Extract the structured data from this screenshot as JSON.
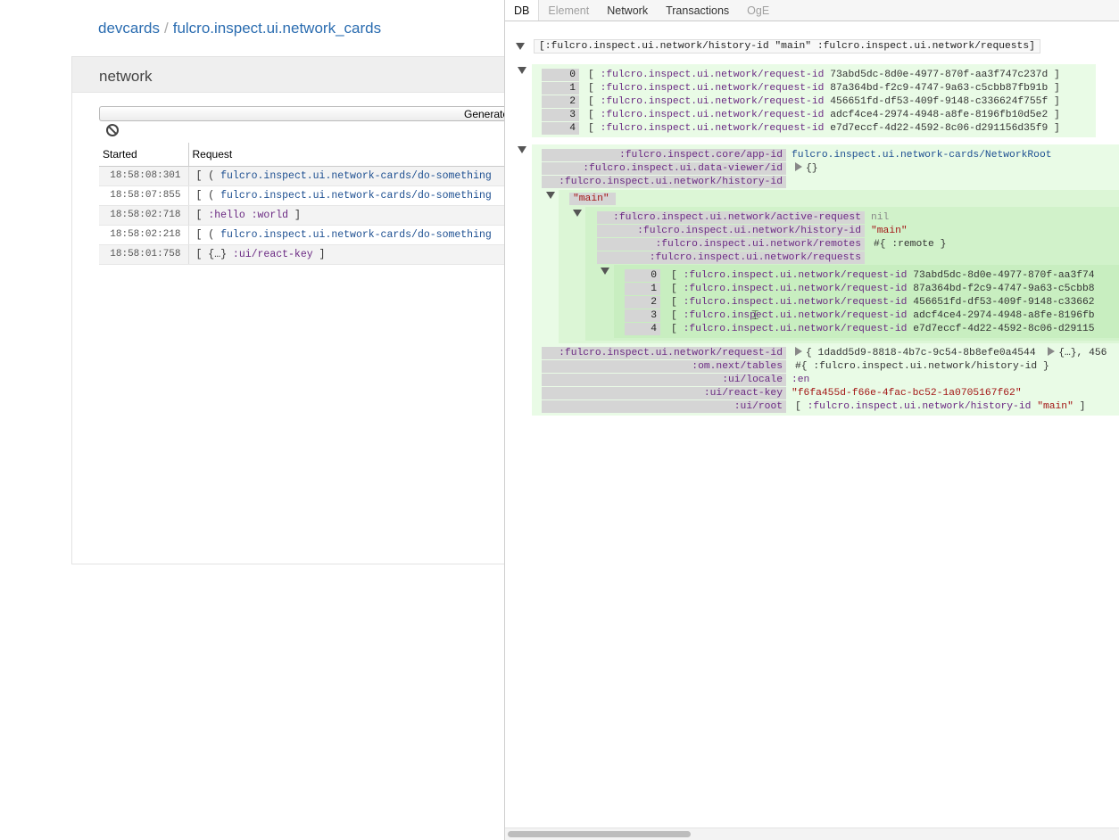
{
  "breadcrumb": {
    "root": "devcards",
    "separator": "/",
    "ns": "fulcro.inspect.ui.network_cards"
  },
  "card": {
    "title": "network",
    "generate_label": "Generate",
    "columns": [
      "Started",
      "Request"
    ],
    "rows": [
      {
        "started": "18:58:08:301",
        "prefix": "[ (",
        "sym": "fulcro.inspect.ui.network-cards/do-something"
      },
      {
        "started": "18:58:07:855",
        "prefix": "[ (",
        "sym": "fulcro.inspect.ui.network-cards/do-something"
      },
      {
        "started": "18:58:02:718",
        "prefix": "[",
        "kw": ":hello :world",
        "suffix": "]"
      },
      {
        "started": "18:58:02:218",
        "prefix": "[ (",
        "sym": "fulcro.inspect.ui.network-cards/do-something"
      },
      {
        "started": "18:58:01:758",
        "prefix": "[ {…}",
        "kw": ":ui/react-key",
        "suffix": "]"
      }
    ]
  },
  "inspector": {
    "tabs": [
      {
        "label": "DB",
        "state": "active"
      },
      {
        "label": "Element",
        "state": "disabled"
      },
      {
        "label": "Network",
        "state": "normal"
      },
      {
        "label": "Transactions",
        "state": "normal"
      },
      {
        "label": "OgE",
        "state": "disabled"
      }
    ],
    "path": "[:fulcro.inspect.ui.network/history-id \"main\" :fulcro.inspect.ui.network/requests]",
    "request_key": ":fulcro.inspect.ui.network/request-id",
    "requests_top": [
      {
        "idx": "0",
        "id": "73abd5dc-8d0e-4977-870f-aa3f747c237d"
      },
      {
        "idx": "1",
        "id": "87a364bd-f2c9-4747-9a63-c5cbb87fb91b"
      },
      {
        "idx": "2",
        "id": "456651fd-df53-409f-9148-c336624f755f"
      },
      {
        "idx": "3",
        "id": "adcf4ce4-2974-4948-a8fe-8196fb10d5e2"
      },
      {
        "idx": "4",
        "id": "e7d7eccf-4d22-4592-8c06-d291156d35f9"
      }
    ],
    "db": {
      "app_id_key": ":fulcro.inspect.core/app-id",
      "app_id_val": "fulcro.inspect.ui.network-cards/NetworkRoot",
      "data_viewer_key": ":fulcro.inspect.ui.data-viewer/id",
      "data_viewer_val": "{}",
      "history_key": ":fulcro.inspect.ui.network/history-id",
      "main_label": "\"main\"",
      "active_request_key": ":fulcro.inspect.ui.network/active-request",
      "active_request_val": "nil",
      "inner_history_key": ":fulcro.inspect.ui.network/history-id",
      "inner_history_val": "\"main\"",
      "remotes_key": ":fulcro.inspect.ui.network/remotes",
      "remotes_val": "#{ :remote }",
      "requests_key": ":fulcro.inspect.ui.network/requests",
      "requests_inner": [
        {
          "idx": "0",
          "id": "73abd5dc-8d0e-4977-870f-aa3f74"
        },
        {
          "idx": "1",
          "id": "87a364bd-f2c9-4747-9a63-c5cbb8"
        },
        {
          "idx": "2",
          "id": "456651fd-df53-409f-9148-c33662"
        },
        {
          "idx": "3",
          "id": "adcf4ce4-2974-4948-a8fe-8196fb"
        },
        {
          "idx": "4",
          "id": "e7d7eccf-4d22-4592-8c06-d29115"
        }
      ],
      "request_id_key": ":fulcro.inspect.ui.network/request-id",
      "request_id_val_a": "{ 1dadd5d9-8818-4b7c-9c54-8b8efe0a4544",
      "request_id_val_b": "{…}, 456",
      "tables_key": ":om.next/tables",
      "tables_val": "#{ :fulcro.inspect.ui.network/history-id }",
      "locale_key": ":ui/locale",
      "locale_val": ":en",
      "react_key_key": ":ui/react-key",
      "react_key_val": "\"f6fa455d-f66e-4fac-bc52-1a0705167f62\"",
      "root_key": ":ui/root",
      "root_val_kw": ":fulcro.inspect.ui.network/history-id",
      "root_val_str": "\"main\""
    }
  }
}
